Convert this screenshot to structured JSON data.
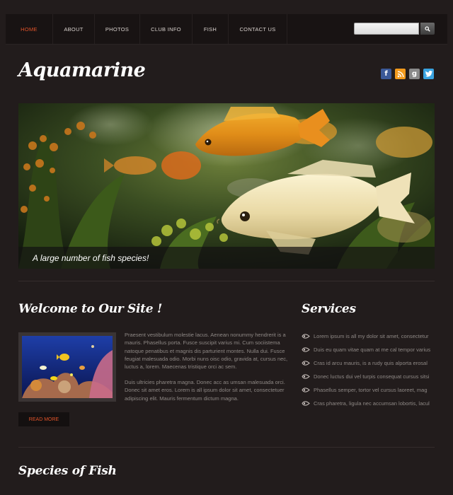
{
  "nav": {
    "items": [
      {
        "label": "HOME",
        "active": true
      },
      {
        "label": "ABOUT",
        "active": false
      },
      {
        "label": "PHOTOS",
        "active": false
      },
      {
        "label": "CLUB INFO",
        "active": false
      },
      {
        "label": "FISH",
        "active": false
      },
      {
        "label": "CONTACT US",
        "active": false
      }
    ]
  },
  "search": {
    "placeholder": "",
    "button_icon": "search-icon"
  },
  "site": {
    "title": "Aquamarine"
  },
  "social": [
    "facebook-icon",
    "rss-icon",
    "google-icon",
    "twitter-icon"
  ],
  "hero": {
    "caption": "A large number of fish species!"
  },
  "welcome": {
    "heading": "Welcome to Our Site !",
    "paragraph1": "Praesent vestibulum molestie lacus. Aenean nonummy hendrerit is a mauris. Phasellus porta. Fusce suscipit varius mi. Cum sociistema natoque penatibus et magnis dis parturient montes. Nulla dui. Fusce feugiat malesuada odio. Morbi nuns oisc odio, gravida at, cursus nec, luctus a, lorem. Maecenas tristique orci ac sem.",
    "paragraph2": "Duis ultricies pharetra magna. Donec acc as umsan malesuada orci. Donec sit amet eros. Lorem is all ipsum dolor sit amet, consectetuer adipiscing elit. Mauris fermentum dictum magna.",
    "read_more": "READ MORE"
  },
  "services": {
    "heading": "Services",
    "items": [
      "Lorem ipsum is all my dolor sit amet, consectetur",
      "Duis eu quam vitae quam at me cal tempor varius",
      "Cras id arcu mauris, is a rudy quis alporta erosal",
      "Donec luctus dui vel turpis consequat cursus sitsi",
      "Phasellus semper, tortor vel cursus laoreet, mag",
      "Cras pharetra, ligula nec accumsan lobortis, lacul"
    ]
  },
  "species": {
    "heading": "Species of Fish"
  },
  "colors": {
    "accent": "#e0532a",
    "background": "#221c1c",
    "navbar": "#181313"
  }
}
